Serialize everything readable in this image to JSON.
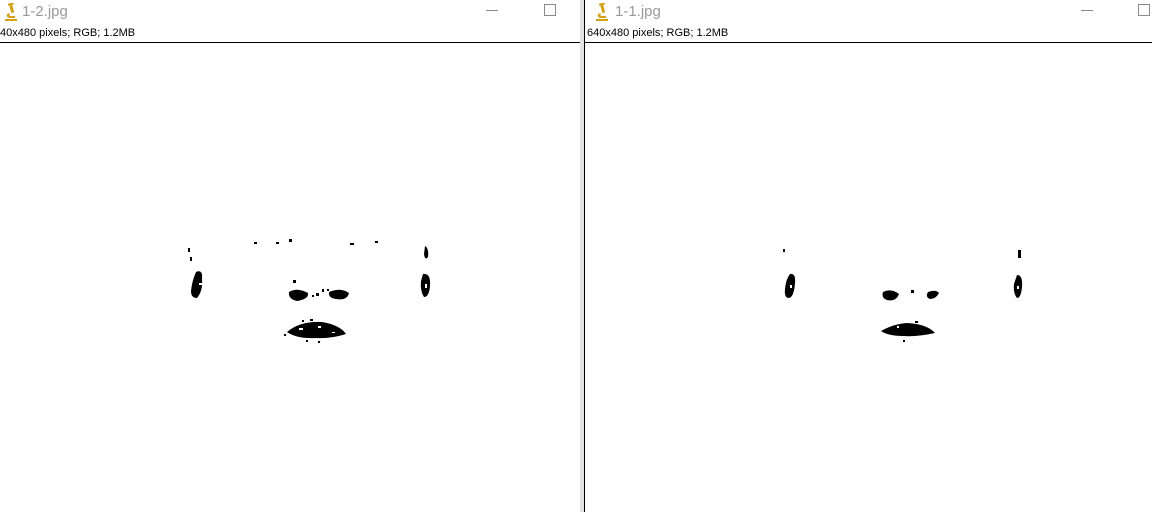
{
  "windows": [
    {
      "title": "1-2.jpg",
      "info": "40x480 pixels; RGB; 1.2MB",
      "icon": "microscope-icon"
    },
    {
      "title": "1-1.jpg",
      "info": "640x480 pixels; RGB; 1.2MB",
      "icon": "microscope-icon"
    }
  ],
  "colors": {
    "icon": "#d4a017",
    "title_text": "#9a9a9a",
    "blob": "#000000",
    "background": "#ffffff"
  }
}
